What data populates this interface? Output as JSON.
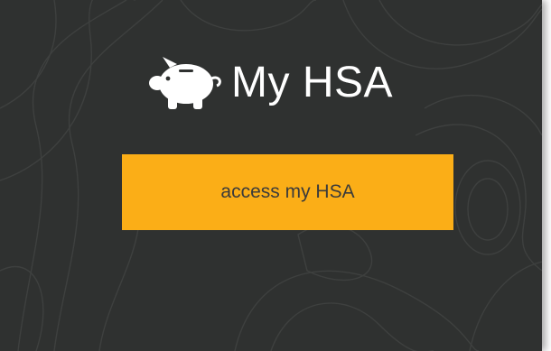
{
  "header": {
    "icon": "piggy-bank-icon",
    "title": "My HSA"
  },
  "access_button": {
    "label": "access my HSA"
  },
  "colors": {
    "background": "#2f3130",
    "button": "#fbae17",
    "button_text": "#3b3b3b",
    "title_text": "#ffffff",
    "pattern_lines": "#3d3f3e"
  }
}
